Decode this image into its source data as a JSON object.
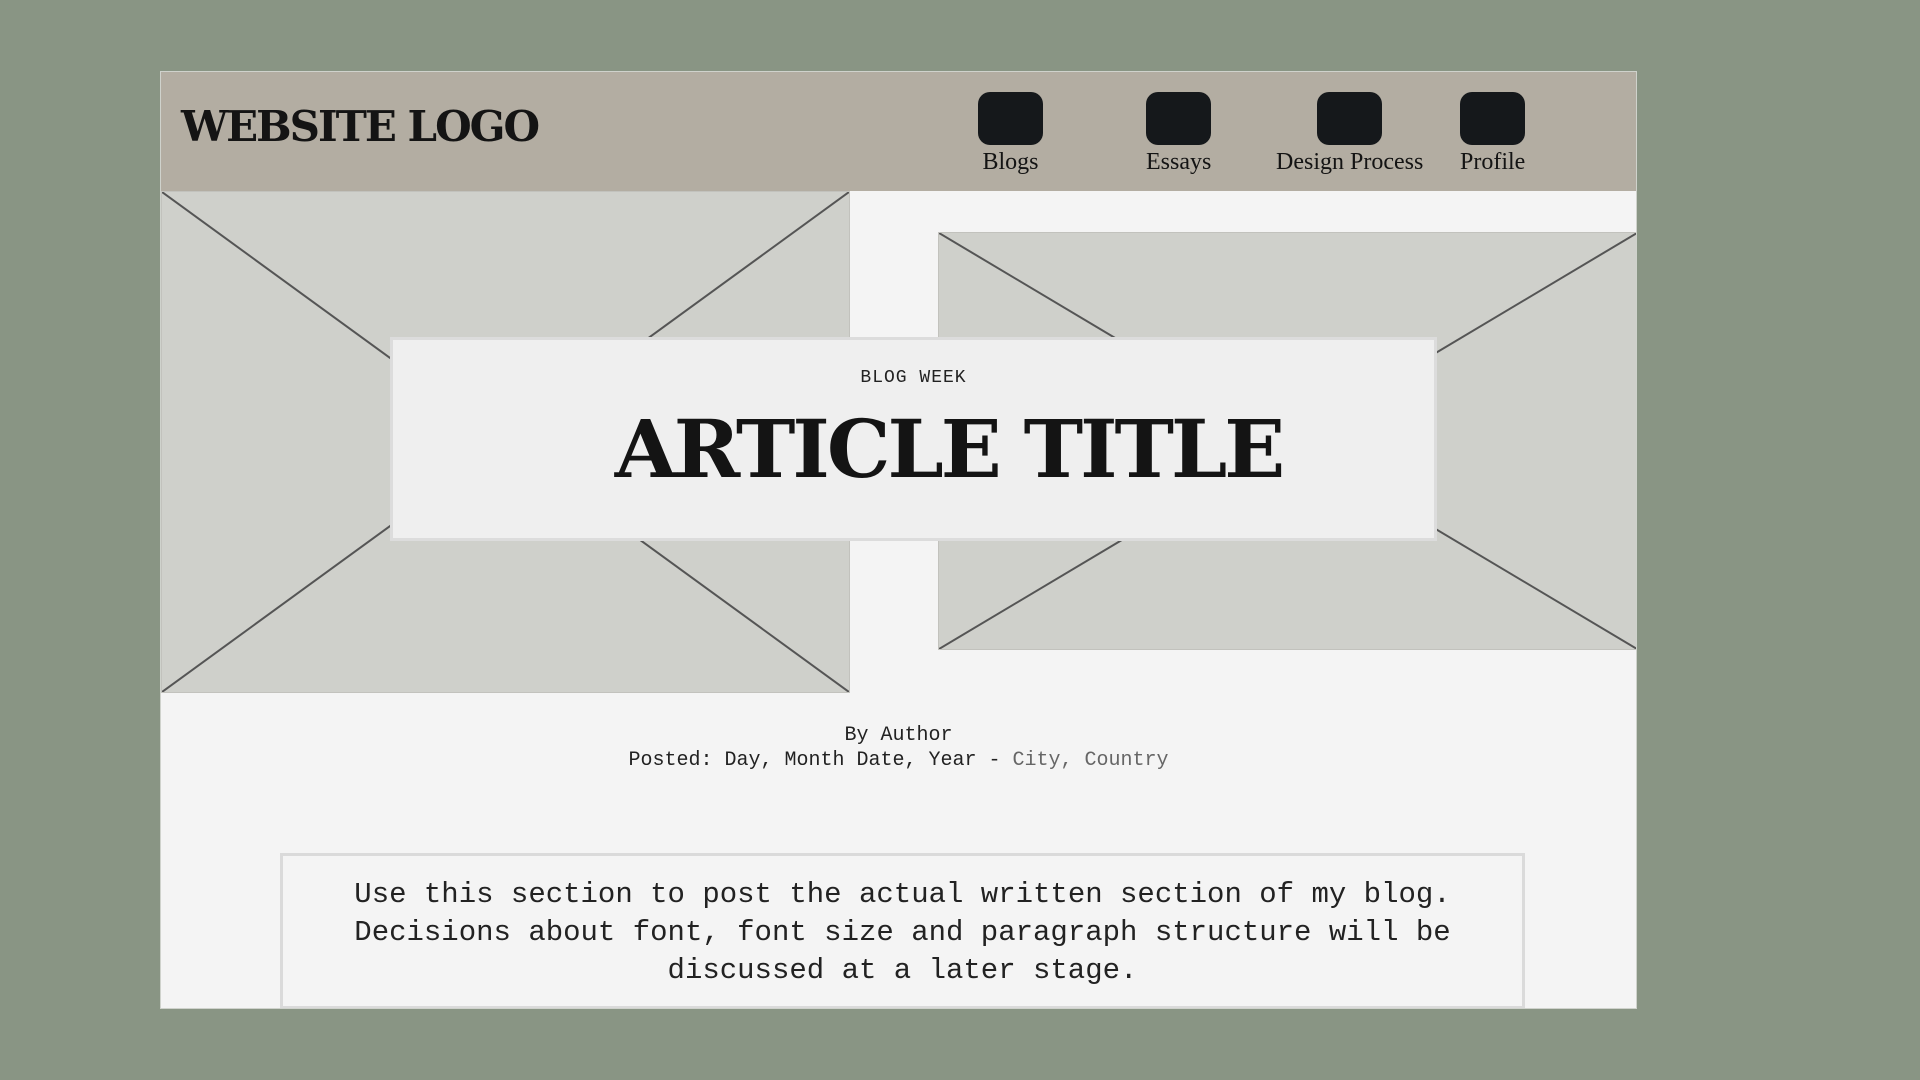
{
  "header": {
    "logo": "WEBSITE LOGO",
    "nav": [
      {
        "label": "Blogs",
        "icon": "nav-placeholder-icon"
      },
      {
        "label": "Essays",
        "icon": "nav-placeholder-icon"
      },
      {
        "label": "Design Process",
        "icon": "nav-placeholder-icon"
      },
      {
        "label": "Profile",
        "icon": "nav-placeholder-icon"
      }
    ]
  },
  "article": {
    "kicker": "BLOG WEEK",
    "title": "ARTICLE TITLE",
    "author": "By Author",
    "posted_prefix": "Posted: Day, Month Date, Year - ",
    "location": "City, Country",
    "body": "Use this section to post the actual written section of my blog. Decisions about font, font size and paragraph structure will be discussed at a later stage."
  },
  "colors": {
    "background": "#899584",
    "header": "#b3ada2",
    "page": "#f4f4f4",
    "placeholder": "#cfd0cb",
    "nav_icon": "#15181b"
  }
}
